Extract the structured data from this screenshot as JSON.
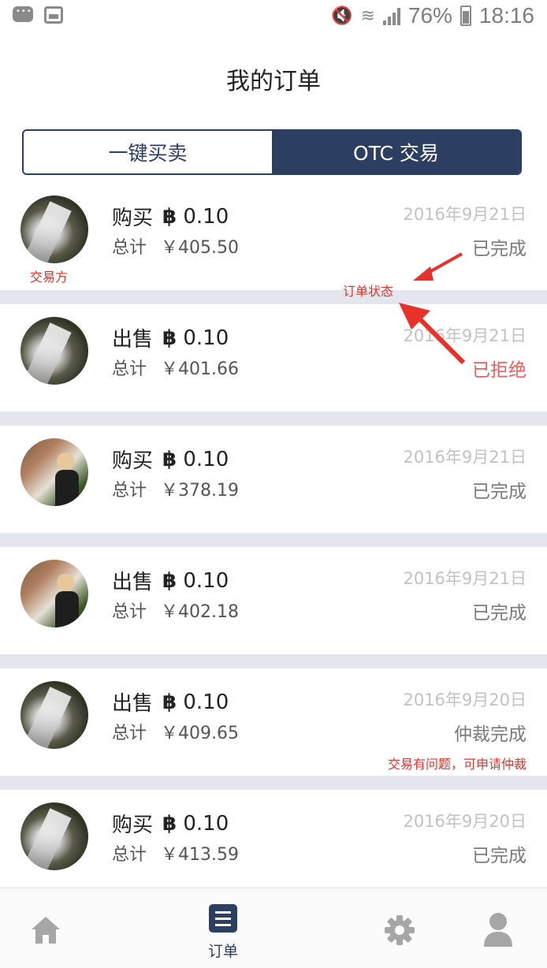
{
  "status_bar": {
    "battery": "76%",
    "time": "18:16"
  },
  "header": {
    "title": "我的订单"
  },
  "tabs": [
    {
      "label": "一键买卖",
      "active": false
    },
    {
      "label": "OTC 交易",
      "active": true
    }
  ],
  "orders": [
    {
      "type": "购买",
      "coin_symbol": "฿",
      "amount": "0.10",
      "total_label": "总计",
      "total": "￥405.50",
      "date": "2016年9月21日",
      "status": "已完成"
    },
    {
      "type": "出售",
      "coin_symbol": "฿",
      "amount": "0.10",
      "total_label": "总计",
      "total": "￥401.66",
      "date": "2016年9月21日",
      "status": "已拒绝"
    },
    {
      "type": "购买",
      "coin_symbol": "฿",
      "amount": "0.10",
      "total_label": "总计",
      "total": "￥378.19",
      "date": "2016年9月21日",
      "status": "已完成"
    },
    {
      "type": "出售",
      "coin_symbol": "฿",
      "amount": "0.10",
      "total_label": "总计",
      "total": "￥402.18",
      "date": "2016年9月21日",
      "status": "已完成"
    },
    {
      "type": "出售",
      "coin_symbol": "฿",
      "amount": "0.10",
      "total_label": "总计",
      "total": "￥409.65",
      "date": "2016年9月20日",
      "status": "仲裁完成"
    },
    {
      "type": "购买",
      "coin_symbol": "฿",
      "amount": "0.10",
      "total_label": "总计",
      "total": "￥413.59",
      "date": "2016年9月20日",
      "status": "已完成"
    }
  ],
  "annotations": {
    "counterparty": "交易方",
    "order_status": "订单状态",
    "arbitration_hint": "交易有问题，可申请仲裁"
  },
  "bottom_nav": {
    "items": [
      {
        "icon": "home-icon"
      },
      {
        "icon": "list-icon",
        "label": "订单",
        "active": true
      },
      {
        "icon": "gear-icon"
      },
      {
        "icon": "user-icon"
      }
    ]
  },
  "colors": {
    "accent": "#2d3e63",
    "rejected": "#f35a5a",
    "annotation": "#e8312b"
  }
}
